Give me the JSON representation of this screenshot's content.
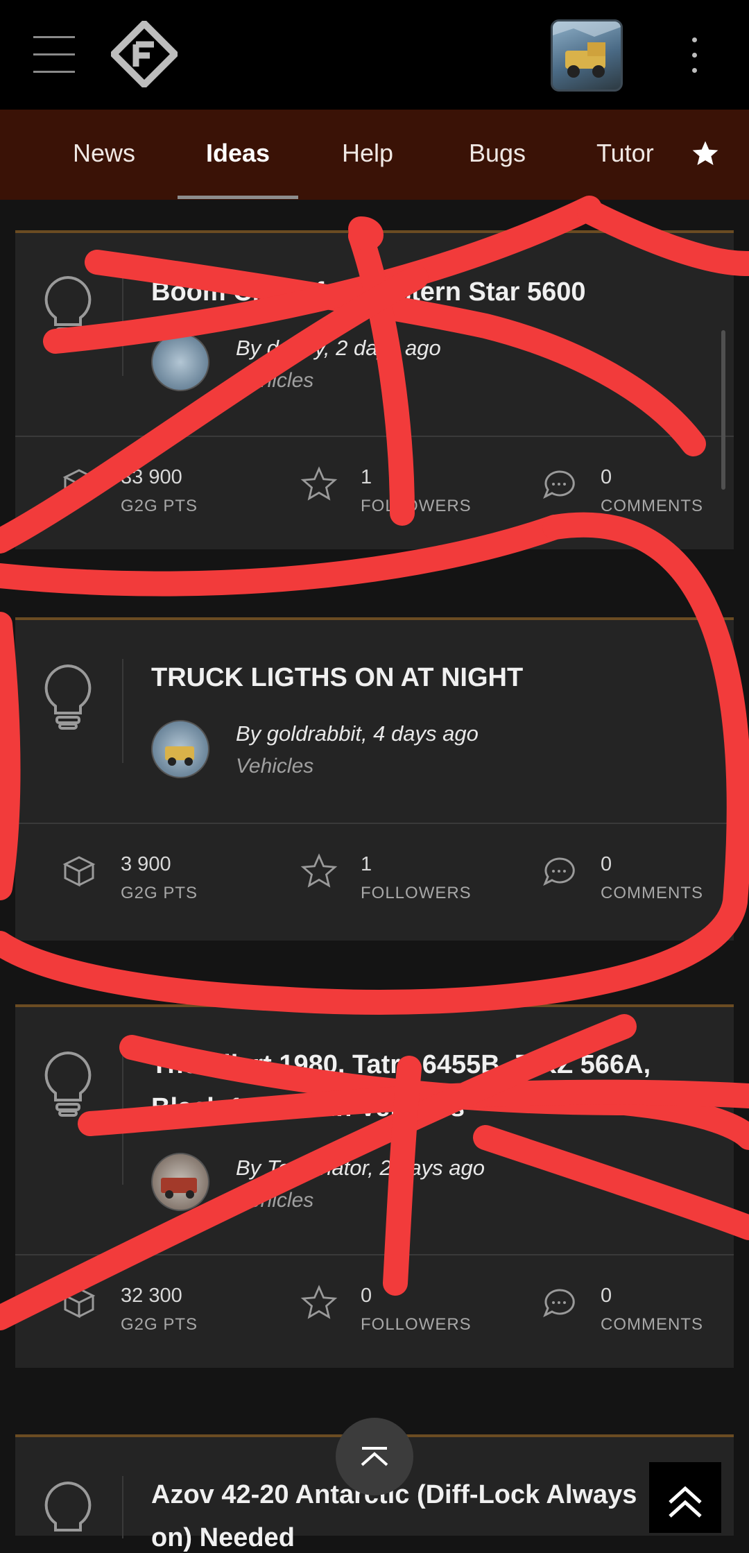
{
  "nav": {
    "tabs": [
      {
        "label": "News"
      },
      {
        "label": "Ideas"
      },
      {
        "label": "Help"
      },
      {
        "label": "Bugs"
      },
      {
        "label": "Tutor"
      }
    ],
    "active_tab": "Ideas"
  },
  "posts": [
    {
      "title": "Boom Crane for Western Star 5600",
      "byline": "By dmitry, 2 days ago",
      "category": "Vehicles",
      "points": "33 900",
      "points_label": "G2G PTS",
      "followers": "1",
      "followers_label": "FOLLOWERS",
      "comments": "0",
      "comments_label": "COMMENTS"
    },
    {
      "title": "TRUCK LIGTHS ON AT NIGHT",
      "byline": "By goldrabbit, 4 days ago",
      "category": "Vehicles",
      "points": "3 900",
      "points_label": "G2G PTS",
      "followers": "1",
      "followers_label": "FOLLOWERS",
      "comments": "0",
      "comments_label": "COMMENTS"
    },
    {
      "title_line1": "The Allert 1980, Tatra 6455B, ZiKZ 566A,",
      "title_line2": "Black 1 9C 10 in Vehicles",
      "byline": "By Terminator, 2 days ago",
      "category": "Vehicles",
      "points": "32 300",
      "points_label": "G2G PTS",
      "followers": "0",
      "followers_label": "FOLLOWERS",
      "comments": "0",
      "comments_label": "COMMENTS"
    },
    {
      "title_line1": "Azov 42-20 Antarctic (Diff-Lock Always",
      "title_line2": "on) Needed"
    }
  ],
  "colors": {
    "scribble": "#f23b3b",
    "tab_bar": "#3a1206",
    "card_accent": "#6b4c22"
  }
}
